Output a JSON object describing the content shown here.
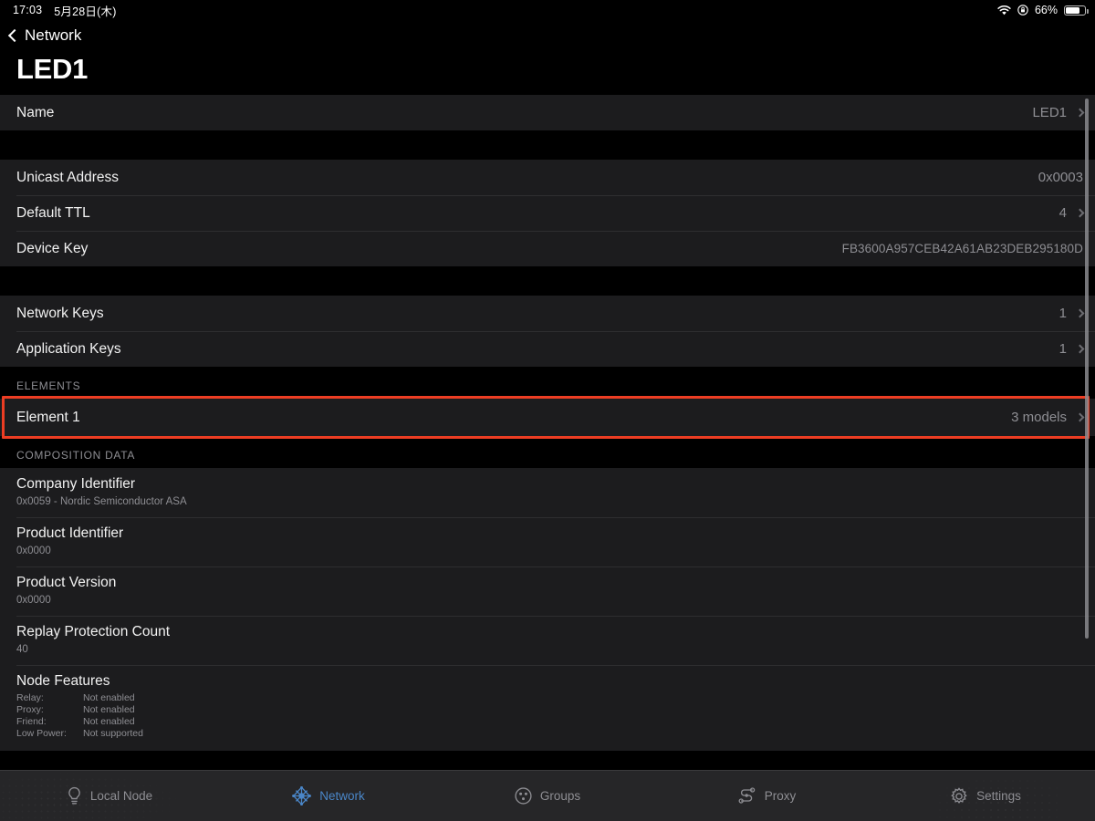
{
  "status_bar": {
    "time": "17:03",
    "date": "5月28日(木)",
    "wifi_icon": "wifi-icon",
    "orientation_lock_icon": "rotation-lock-icon",
    "battery_percent": "66%",
    "battery_icon": "battery-icon",
    "battery_level": 66
  },
  "nav": {
    "back_label": "Network",
    "back_icon": "chevron-left-icon",
    "title": "LED1"
  },
  "sections": {
    "name_section": {
      "rows": [
        {
          "label": "Name",
          "value": "LED1",
          "chevron": true
        }
      ]
    },
    "address_section": {
      "rows": [
        {
          "label": "Unicast Address",
          "value": "0x0003",
          "chevron": false
        },
        {
          "label": "Default TTL",
          "value": "4",
          "chevron": true
        },
        {
          "label": "Device Key",
          "value": "FB3600A957CEB42A61AB23DEB295180D",
          "chevron": false,
          "mono": true
        }
      ]
    },
    "keys_section": {
      "rows": [
        {
          "label": "Network Keys",
          "value": "1",
          "chevron": true
        },
        {
          "label": "Application Keys",
          "value": "1",
          "chevron": true
        }
      ]
    },
    "elements_section": {
      "header": "ELEMENTS",
      "rows": [
        {
          "label": "Element 1",
          "value": "3 models",
          "chevron": true,
          "highlighted": true
        }
      ]
    },
    "composition_section": {
      "header": "COMPOSITION DATA",
      "rows": [
        {
          "title": "Company Identifier",
          "subtitle": "0x0059 - Nordic Semiconductor ASA"
        },
        {
          "title": "Product Identifier",
          "subtitle": "0x0000"
        },
        {
          "title": "Product Version",
          "subtitle": "0x0000"
        },
        {
          "title": "Replay Protection Count",
          "subtitle": "40"
        }
      ],
      "node_features": {
        "title": "Node Features",
        "items": [
          {
            "key": "Relay:",
            "value": "Not enabled"
          },
          {
            "key": "Proxy:",
            "value": "Not enabled"
          },
          {
            "key": "Friend:",
            "value": "Not enabled"
          },
          {
            "key": "Low Power:",
            "value": "Not supported"
          }
        ]
      }
    }
  },
  "tabbar": {
    "tabs": [
      {
        "label": "Local Node",
        "icon": "lightbulb-icon",
        "active": false
      },
      {
        "label": "Network",
        "icon": "mesh-network-icon",
        "active": true
      },
      {
        "label": "Groups",
        "icon": "groups-icon",
        "active": false
      },
      {
        "label": "Proxy",
        "icon": "proxy-icon",
        "active": false
      },
      {
        "label": "Settings",
        "icon": "gear-icon",
        "active": false
      }
    ]
  },
  "colors": {
    "accent_blue": "#4a86c8",
    "highlight_red": "#ec3d23",
    "row_bg": "#1c1c1e",
    "secondary_text": "#8e8e93"
  }
}
